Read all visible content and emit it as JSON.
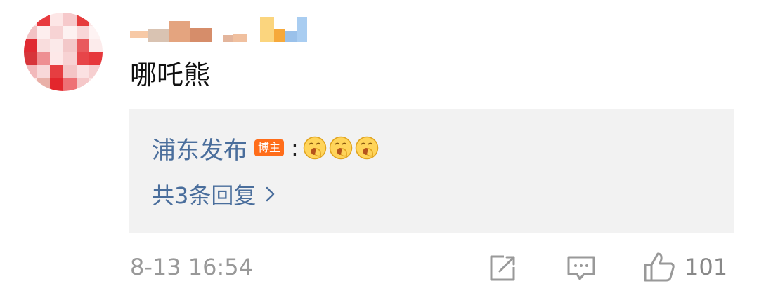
{
  "comment": {
    "text": "哪吒熊",
    "timestamp": "8-13 16:54",
    "like_count": "101"
  },
  "reply_preview": {
    "author": "浦东发布",
    "badge": "博主",
    "colon": ":",
    "emojis": [
      "yawn-emoji",
      "yawn-emoji",
      "yawn-emoji"
    ],
    "reply_count_label": "共3条回复"
  },
  "icons": {
    "share": "share-icon",
    "comment": "comment-icon",
    "like": "thumbs-up-icon",
    "chevron": "chevron-right-icon"
  },
  "colors": {
    "link": "#4a6e9c",
    "badge": "#ff6d1a",
    "reply_bg": "#f2f2f2",
    "meta": "#999999"
  }
}
